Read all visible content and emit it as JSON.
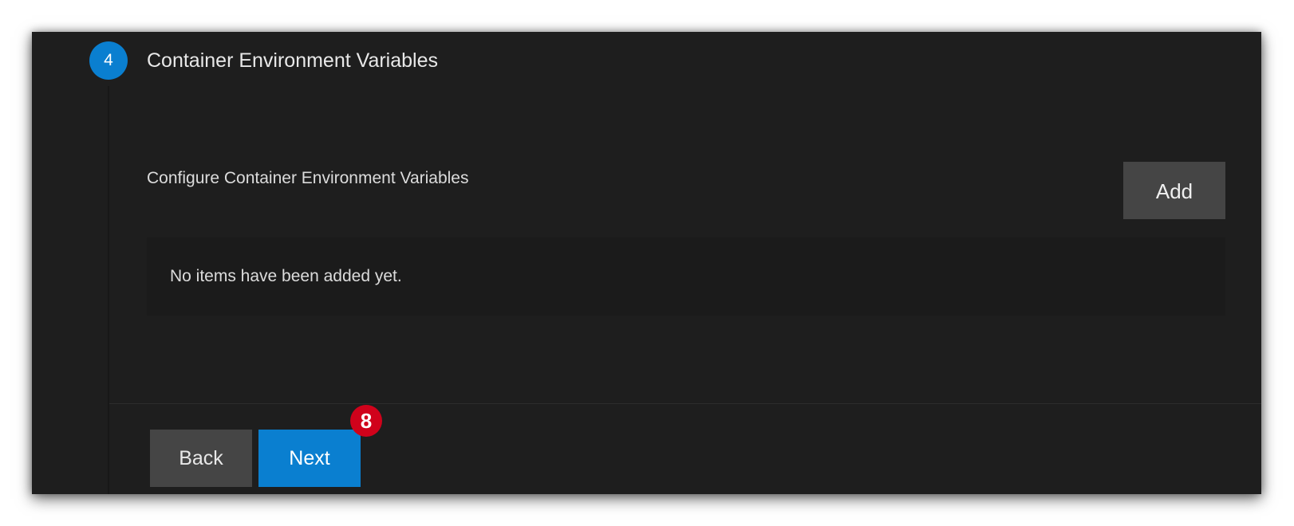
{
  "step": {
    "number": "4",
    "title": "Container Environment Variables"
  },
  "env_vars": {
    "label": "Configure Container Environment Variables",
    "add_label": "Add",
    "empty_message": "No items have been added yet.",
    "items": []
  },
  "footer": {
    "back_label": "Back",
    "next_label": "Next",
    "next_badge": "8"
  },
  "colors": {
    "accent": "#0a7fd0",
    "badge": "#d0021b",
    "background": "#1e1e1e",
    "secondary_button": "#454545"
  }
}
